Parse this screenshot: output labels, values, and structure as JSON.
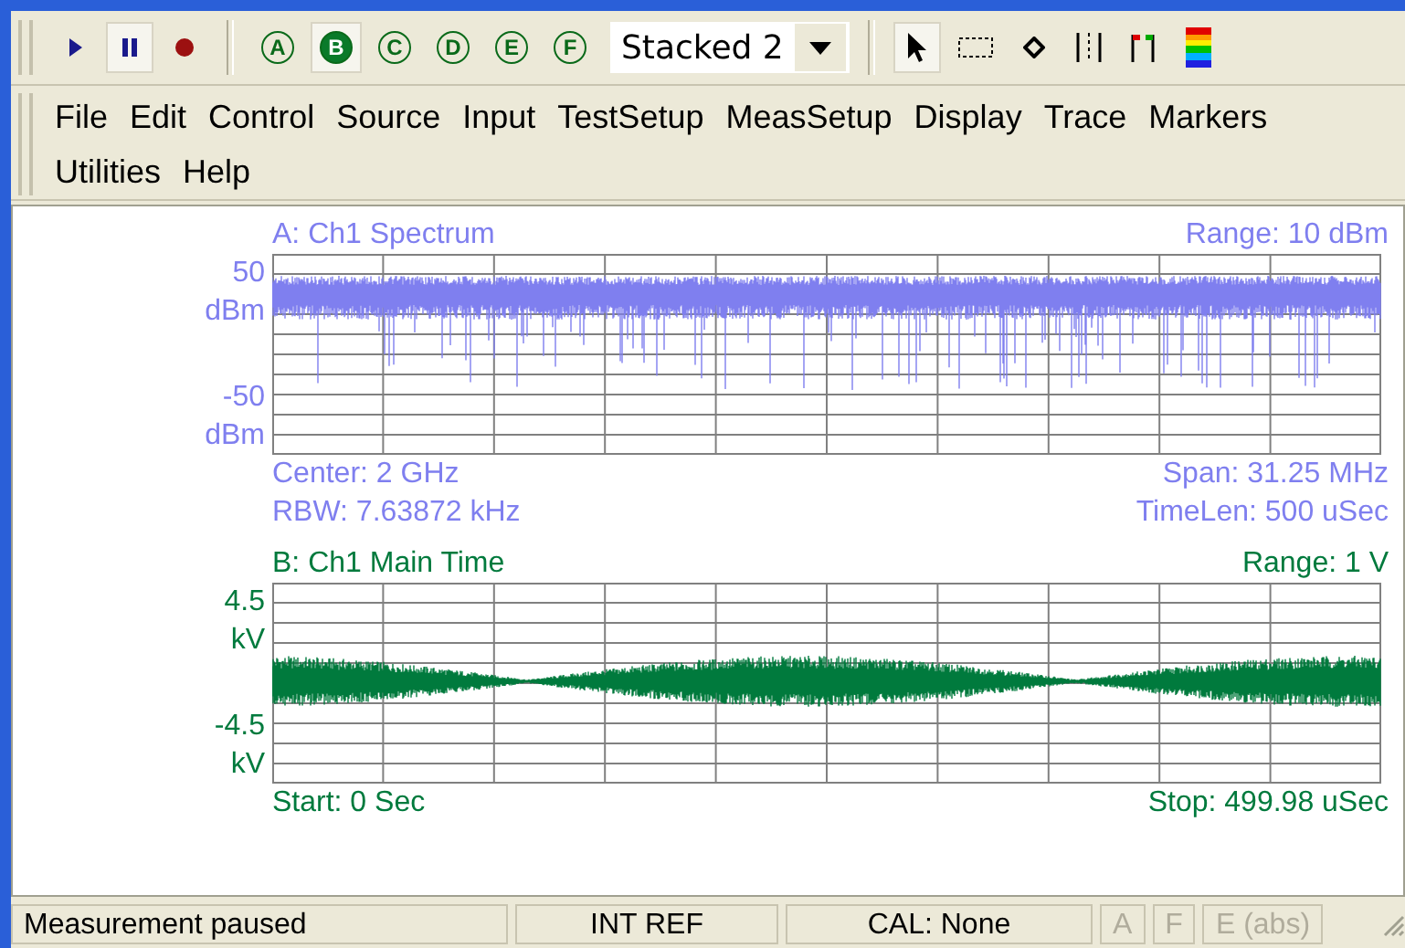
{
  "toolbar": {
    "transport": [
      {
        "kind": "play",
        "selected": false
      },
      {
        "kind": "pause",
        "selected": true
      },
      {
        "kind": "record",
        "selected": false
      }
    ],
    "traces": [
      {
        "letter": "A",
        "selected": false
      },
      {
        "letter": "B",
        "selected": true
      },
      {
        "letter": "C",
        "selected": false
      },
      {
        "letter": "D",
        "selected": false
      },
      {
        "letter": "E",
        "selected": false
      },
      {
        "letter": "F",
        "selected": false
      }
    ],
    "layout_dropdown": {
      "value": "Stacked 2"
    },
    "tools": [
      {
        "kind": "pointer",
        "selected": true
      },
      {
        "kind": "box",
        "selected": false
      },
      {
        "kind": "diamond",
        "selected": false
      },
      {
        "kind": "lines",
        "selected": false
      },
      {
        "kind": "flags",
        "selected": false
      },
      {
        "kind": "palette",
        "selected": false
      }
    ]
  },
  "menu": [
    "File",
    "Edit",
    "Control",
    "Source",
    "Input",
    "TestSetup",
    "MeasSetup",
    "Display",
    "Trace",
    "Markers",
    "Utilities",
    "Help"
  ],
  "plots": [
    {
      "kind": "spectrum",
      "color": "#7f7fef",
      "title": "A: Ch1 Spectrum",
      "range": "Range: 10 dBm",
      "y_labels": [
        "50",
        "dBm",
        "-50",
        "dBm"
      ],
      "footer": [
        {
          "left": "Center: 2 GHz",
          "right": "Span: 31.25 MHz"
        },
        {
          "left": "RBW: 7.63872 kHz",
          "right": "TimeLen: 500 uSec"
        }
      ]
    },
    {
      "kind": "time",
      "color": "#007a3d",
      "title": "B: Ch1 Main Time",
      "range": "Range: 1  V",
      "y_labels": [
        "4.5",
        "kV",
        "-4.5",
        "kV"
      ],
      "footer": [
        {
          "left": "Start: 0  Sec",
          "right": "Stop: 499.98 uSec"
        }
      ]
    }
  ],
  "status_bar": [
    {
      "text": "Measurement paused",
      "disabled": false
    },
    {
      "text": "INT REF",
      "disabled": false
    },
    {
      "text": "CAL: None",
      "disabled": false
    },
    {
      "text": "A",
      "disabled": true
    },
    {
      "text": "F",
      "disabled": true
    },
    {
      "text": "E (abs)",
      "disabled": true
    }
  ]
}
